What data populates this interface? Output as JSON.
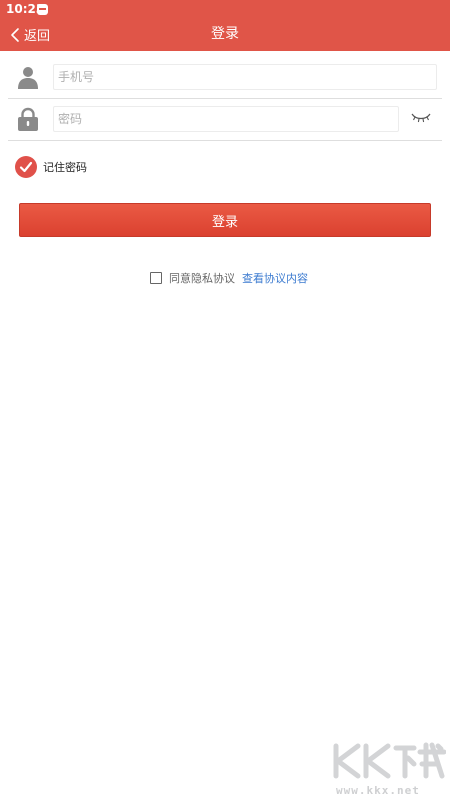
{
  "status_bar": {
    "time": "10:23"
  },
  "nav": {
    "back_label": "返回",
    "title": "登录"
  },
  "form": {
    "phone_placeholder": "手机号",
    "password_placeholder": "密码",
    "remember_label": "记住密码",
    "remember_checked": true,
    "login_button": "登录"
  },
  "agreement": {
    "label": "同意隐私协议",
    "link": "查看协议内容",
    "checked": false
  },
  "watermark": {
    "logo_text": "KK下载",
    "url": "www.kkx.net"
  },
  "colors": {
    "brand": "#e05548",
    "button": "#e04a37",
    "link": "#3c7bd0"
  },
  "icons": {
    "back": "chevron-left-icon",
    "phone": "user-icon",
    "password": "lock-icon",
    "toggle_visibility": "eye-closed-icon",
    "remember": "checkmark-icon"
  }
}
